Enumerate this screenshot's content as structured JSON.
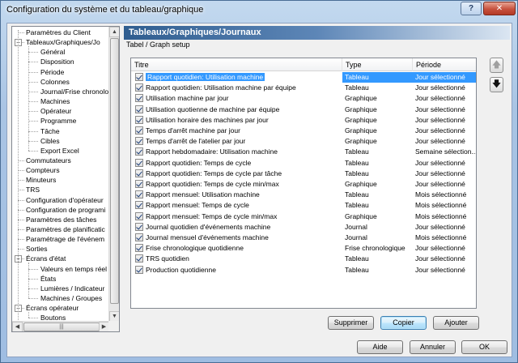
{
  "window": {
    "title": "Configuration du système et du tableau/graphique",
    "help_label": "?",
    "close_label": "✕"
  },
  "tree": {
    "items": [
      {
        "label": "Paramètres du Client",
        "level": 0,
        "expander": "",
        "dots": true
      },
      {
        "label": "Tableaux/Graphiques/Jo",
        "level": 0,
        "expander": "−"
      },
      {
        "label": "Général",
        "level": 1
      },
      {
        "label": "Disposition",
        "level": 1
      },
      {
        "label": "Période",
        "level": 1
      },
      {
        "label": "Colonnes",
        "level": 1
      },
      {
        "label": "Journal/Frise chronolo",
        "level": 1
      },
      {
        "label": "Machines",
        "level": 1
      },
      {
        "label": "Opérateur",
        "level": 1
      },
      {
        "label": "Programme",
        "level": 1
      },
      {
        "label": "Tâche",
        "level": 1
      },
      {
        "label": "Cibles",
        "level": 1
      },
      {
        "label": "Export Excel",
        "level": 1
      },
      {
        "label": "Commutateurs",
        "level": 0
      },
      {
        "label": "Compteurs",
        "level": 0
      },
      {
        "label": "Minuteurs",
        "level": 0
      },
      {
        "label": "TRS",
        "level": 0
      },
      {
        "label": "Configuration d'opérateur",
        "level": 0
      },
      {
        "label": "Configuration de programi",
        "level": 0
      },
      {
        "label": "Paramètres des tâches",
        "level": 0
      },
      {
        "label": "Paramètres de planificatic",
        "level": 0
      },
      {
        "label": "Paramétrage de l'événem",
        "level": 0
      },
      {
        "label": "Sorties",
        "level": 0
      },
      {
        "label": "Écrans d'état",
        "level": 0,
        "expander": "−"
      },
      {
        "label": "Valeurs en temps réel",
        "level": 1
      },
      {
        "label": "États",
        "level": 1
      },
      {
        "label": "Lumières / Indicateur",
        "level": 1
      },
      {
        "label": "Machines / Groupes",
        "level": 1
      },
      {
        "label": "Écrans opérateur",
        "level": 0,
        "expander": "−"
      },
      {
        "label": "Boutons",
        "level": 1
      }
    ],
    "hscroll_grip": "|||"
  },
  "panel": {
    "header": "Tableaux/Graphiques/Journaux",
    "subheader": "Tabel / Graph setup"
  },
  "grid": {
    "columns": [
      "Titre",
      "Type",
      "Période"
    ],
    "rows": [
      {
        "title": "Rapport quotidien: Utilisation machine",
        "type": "Tableau",
        "period": "Jour sélectionné",
        "checked": true,
        "selected": true
      },
      {
        "title": "Rapport quotidien: Utilisation machine par équipe",
        "type": "Tableau",
        "period": "Jour sélectionné",
        "checked": true
      },
      {
        "title": "Utilisation machine par jour",
        "type": "Graphique",
        "period": "Jour sélectionné",
        "checked": true
      },
      {
        "title": "Utilisation quotienne de machine par équipe",
        "type": "Graphique",
        "period": "Jour sélectionné",
        "checked": true
      },
      {
        "title": "Utilisation horaire des machines par jour",
        "type": "Graphique",
        "period": "Jour sélectionné",
        "checked": true
      },
      {
        "title": "Temps d'arrêt machine par jour",
        "type": "Graphique",
        "period": "Jour sélectionné",
        "checked": true
      },
      {
        "title": "Temps d'arrêt de l'atelier par jour",
        "type": "Graphique",
        "period": "Jour sélectionné",
        "checked": true
      },
      {
        "title": "Rapport hebdomadaire: Utilisation machine",
        "type": "Tableau",
        "period": "Semaine sélection...",
        "checked": true
      },
      {
        "title": "Rapport quotidien: Temps de cycle",
        "type": "Tableau",
        "period": "Jour sélectionné",
        "checked": true
      },
      {
        "title": "Rapport quotidien: Temps de cycle par tâche",
        "type": "Tableau",
        "period": "Jour sélectionné",
        "checked": true
      },
      {
        "title": "Rapport quotidien: Temps de cycle min/max",
        "type": "Graphique",
        "period": "Jour sélectionné",
        "checked": true
      },
      {
        "title": "Rapport mensuel: Utilisation machine",
        "type": "Tableau",
        "period": "Mois sélectionné",
        "checked": true
      },
      {
        "title": "Rapport mensuel: Temps de cycle",
        "type": "Tableau",
        "period": "Mois sélectionné",
        "checked": true
      },
      {
        "title": "Rapport mensuel: Temps de cycle min/max",
        "type": "Graphique",
        "period": "Mois sélectionné",
        "checked": true
      },
      {
        "title": "Journal quotidien d'événements machine",
        "type": "Journal",
        "period": "Jour sélectionné",
        "checked": true
      },
      {
        "title": "Journal mensuel d'événements machine",
        "type": "Journal",
        "period": "Mois sélectionné",
        "checked": true
      },
      {
        "title": "Frise chronologique quotidienne",
        "type": "Frise chronologique",
        "period": "Jour sélectionné",
        "checked": true
      },
      {
        "title": "TRS quotidien",
        "type": "Tableau",
        "period": "Jour sélectionné",
        "checked": true
      },
      {
        "title": "Production quotidienne",
        "type": "Tableau",
        "period": "Jour sélectionné",
        "checked": true
      }
    ]
  },
  "actions": {
    "delete": "Supprimer",
    "copy": "Copier",
    "add": "Ajouter",
    "move_up": "🡅",
    "move_down": "🡇"
  },
  "footer": {
    "help": "Aide",
    "cancel": "Annuler",
    "ok": "OK"
  }
}
